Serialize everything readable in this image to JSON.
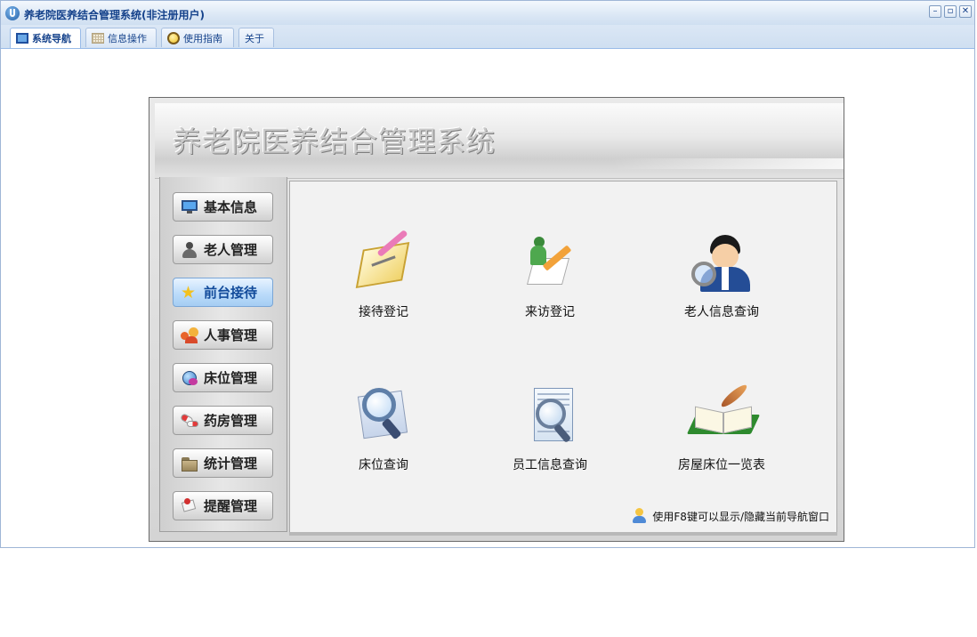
{
  "window": {
    "title": "养老院医养结合管理系统(非注册用户)",
    "controls": {
      "minimize": "–",
      "restore": "▫",
      "close": "✕"
    }
  },
  "tabs": [
    {
      "label": "系统导航",
      "icon": "monitor-icon",
      "active": true
    },
    {
      "label": "信息操作",
      "icon": "grid-icon",
      "active": false
    },
    {
      "label": "使用指南",
      "icon": "help-icon",
      "active": false
    },
    {
      "label": "关于",
      "icon": "",
      "active": false
    }
  ],
  "banner": {
    "title": "养老院医养结合管理系统"
  },
  "sidebar": {
    "items": [
      {
        "label": "基本信息",
        "icon": "monitor-icon",
        "active": false
      },
      {
        "label": "老人管理",
        "icon": "person-icon",
        "active": false
      },
      {
        "label": "前台接待",
        "icon": "star-icon",
        "active": true
      },
      {
        "label": "人事管理",
        "icon": "people-icon",
        "active": false
      },
      {
        "label": "床位管理",
        "icon": "bed-globe-icon",
        "active": false
      },
      {
        "label": "药房管理",
        "icon": "pill-icon",
        "active": false
      },
      {
        "label": "统计管理",
        "icon": "folder-icon",
        "active": false
      },
      {
        "label": "提醒管理",
        "icon": "pushpin-icon",
        "active": false
      }
    ]
  },
  "tiles": [
    {
      "label": "接待登记",
      "icon": "clipboard-pencil-icon"
    },
    {
      "label": "来访登记",
      "icon": "visitor-pencil-icon"
    },
    {
      "label": "老人信息查询",
      "icon": "user-search-icon"
    },
    {
      "label": "床位查询",
      "icon": "magnifier-icon"
    },
    {
      "label": "员工信息查询",
      "icon": "document-search-icon"
    },
    {
      "label": "房屋床位一览表",
      "icon": "book-quill-icon"
    }
  ],
  "tip": {
    "text": "使用F8键可以显示/隐藏当前导航窗口",
    "icon": "user-tip-icon"
  },
  "colors": {
    "accent": "#15428b",
    "active_nav": "#bcdcfa",
    "panel_bg": "#f2f2f2"
  }
}
